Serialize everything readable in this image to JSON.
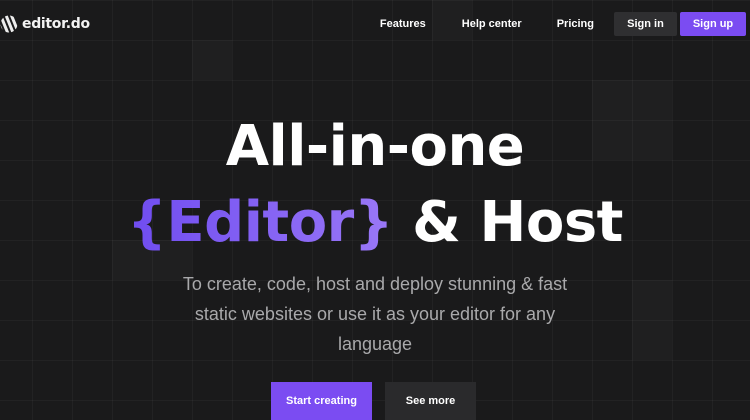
{
  "brand": {
    "name": "editor.do",
    "icon": "striped-logo-icon"
  },
  "nav": {
    "features": "Features",
    "help_center": "Help center",
    "pricing": "Pricing",
    "sign_in": "Sign in",
    "sign_up": "Sign up"
  },
  "hero": {
    "line1": "All-in-one",
    "accent": "{Editor}",
    "line2_rest": " & Host",
    "subtitle": "To create, code, host and deploy stunning & fast static websites or use it as your editor for any language"
  },
  "cta": {
    "primary": "Start creating",
    "secondary": "See more"
  },
  "colors": {
    "background": "#1a1a1b",
    "accent": "#7b4cf2",
    "secondary_button": "#2a2a2c",
    "subtitle_text": "#a9a9ab"
  }
}
